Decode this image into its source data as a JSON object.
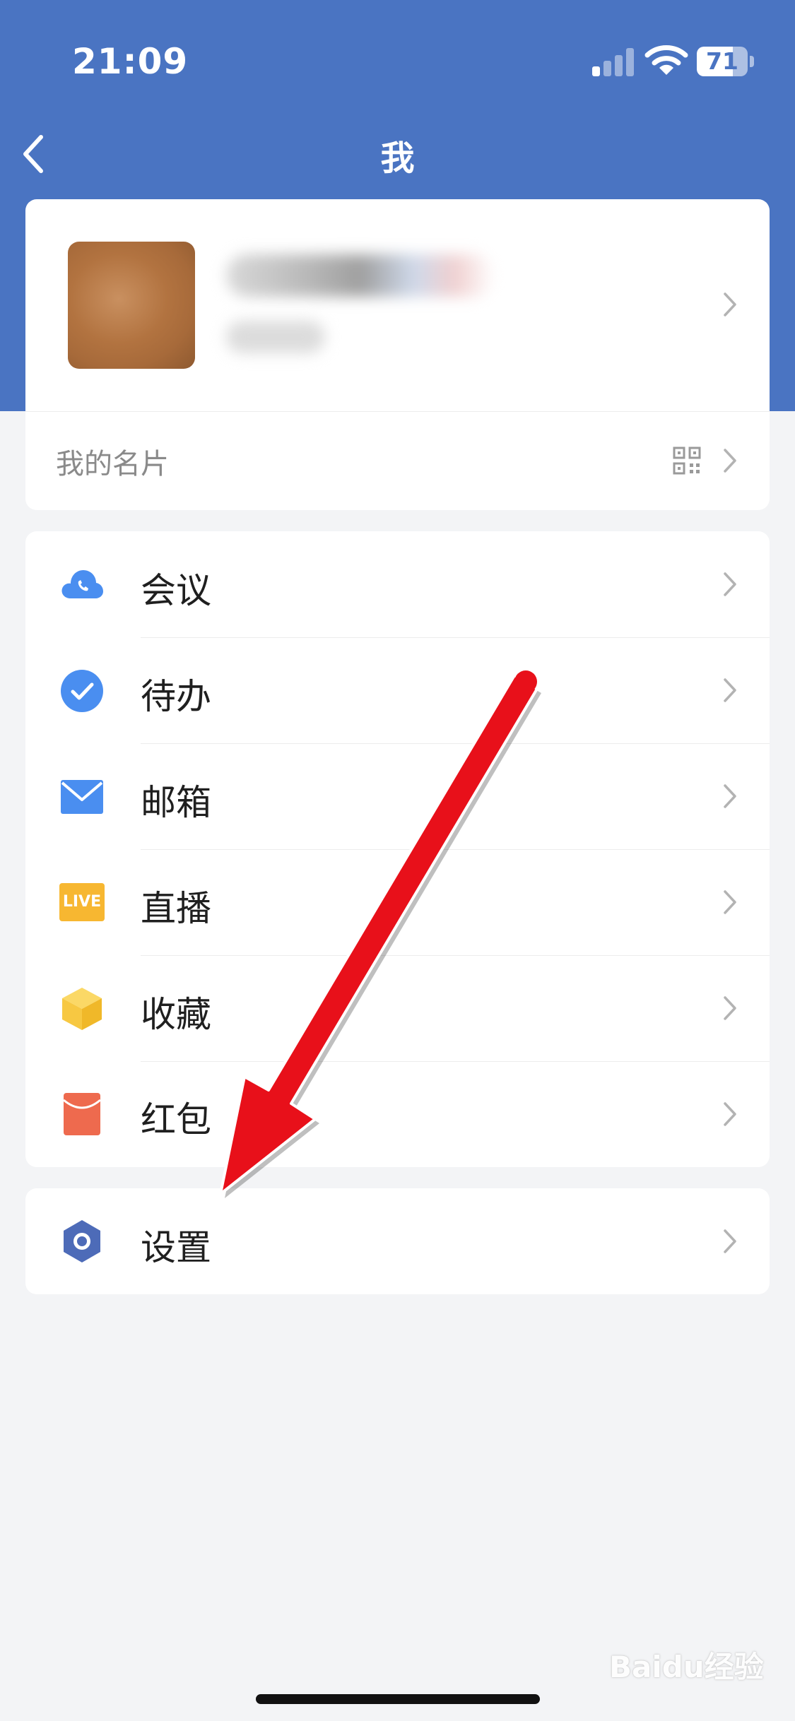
{
  "status": {
    "time": "21:09",
    "battery": "71",
    "battery_level": 0.71
  },
  "nav": {
    "title": "我"
  },
  "profile": {
    "card_label": "我的名片"
  },
  "menu": [
    {
      "label": "会议",
      "icon": "cloud-phone-icon"
    },
    {
      "label": "待办",
      "icon": "check-circle-icon"
    },
    {
      "label": "邮箱",
      "icon": "mail-icon"
    },
    {
      "label": "直播",
      "icon": "live-icon",
      "icon_text": "LIVE"
    },
    {
      "label": "收藏",
      "icon": "box-icon"
    },
    {
      "label": "红包",
      "icon": "red-envelope-icon"
    }
  ],
  "settings": {
    "label": "设置",
    "icon": "hexagon-settings-icon"
  },
  "watermark": "Baidu经验",
  "colors": {
    "header": "#4a74c2",
    "accent_blue": "#4a8ef0",
    "live_orange": "#f7b731",
    "cube_yellow": "#f7c842",
    "red_envelope": "#ee6a4e",
    "settings_hex": "#4d6bb8",
    "arrow_red": "#e8101a"
  }
}
